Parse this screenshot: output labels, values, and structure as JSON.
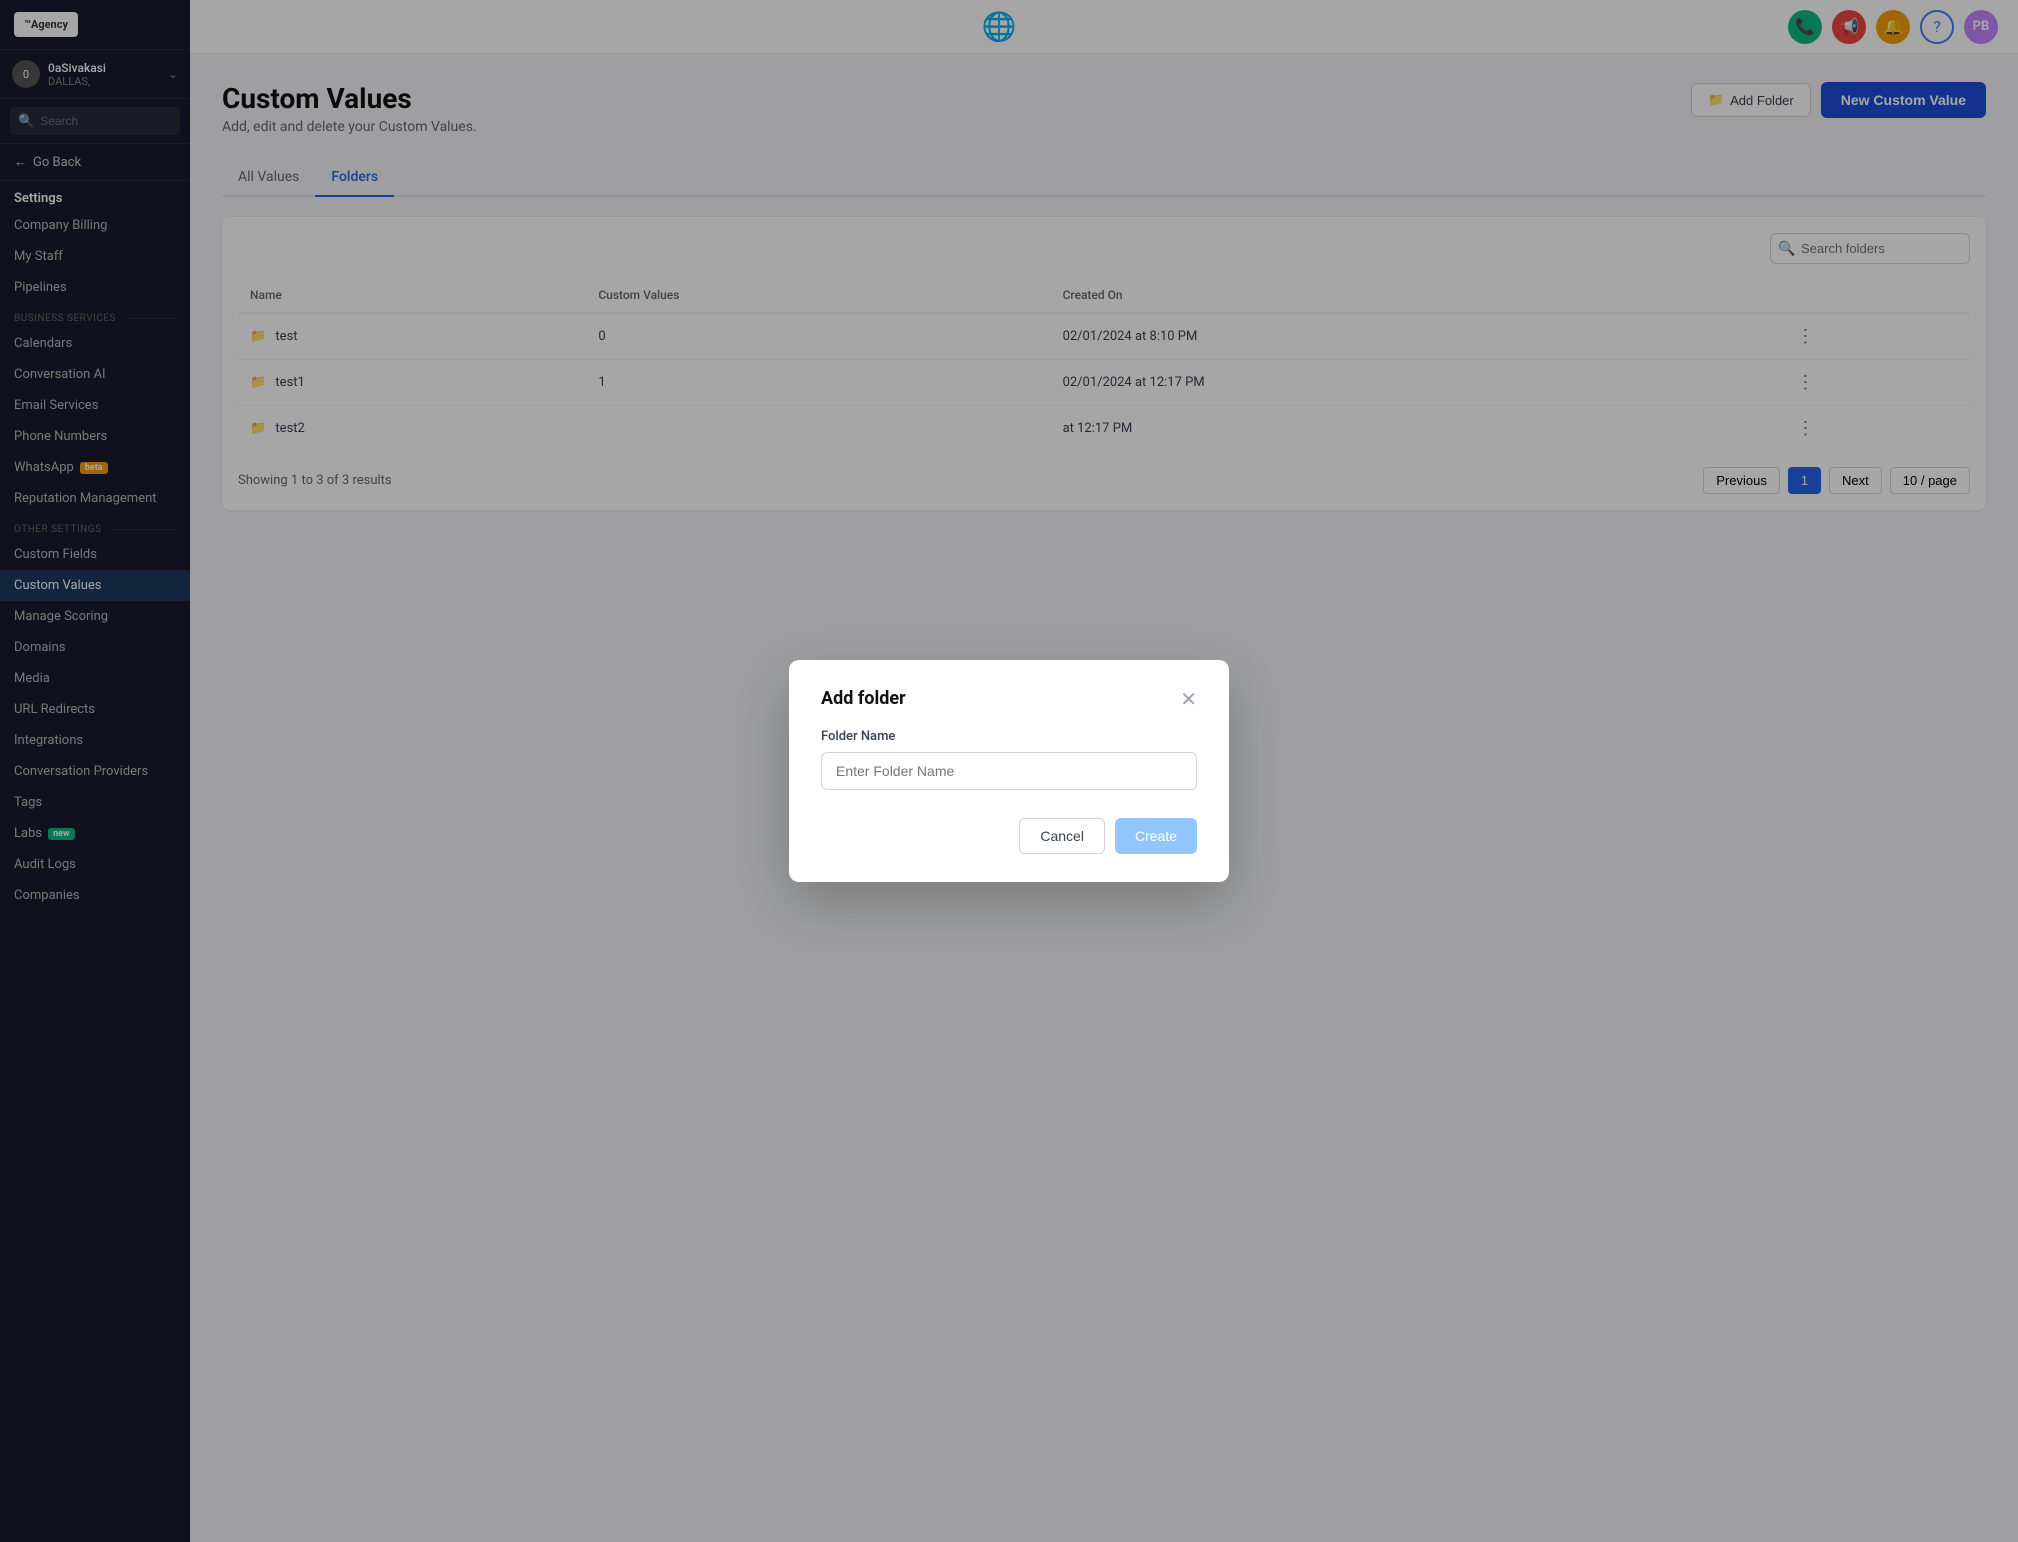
{
  "app": {
    "logo_text": "™Agency",
    "nav_logo_unicode": "🌐"
  },
  "user": {
    "name": "0aSivakasi",
    "location": "DALLAS,",
    "initials": "PB"
  },
  "sidebar": {
    "search_placeholder": "Search",
    "go_back_label": "Go Back",
    "settings_label": "Settings",
    "business_services_label": "BUSINESS SERVICES",
    "other_settings_label": "OTHER SETTINGS",
    "items_main": [
      {
        "id": "company-billing",
        "label": "Company Billing"
      },
      {
        "id": "my-staff",
        "label": "My Staff"
      },
      {
        "id": "pipelines",
        "label": "Pipelines"
      }
    ],
    "items_business": [
      {
        "id": "calendars",
        "label": "Calendars"
      },
      {
        "id": "conversation-ai",
        "label": "Conversation AI"
      },
      {
        "id": "email-services",
        "label": "Email Services"
      },
      {
        "id": "phone-numbers",
        "label": "Phone Numbers"
      },
      {
        "id": "whatsapp",
        "label": "WhatsApp",
        "badge": "beta"
      },
      {
        "id": "reputation-management",
        "label": "Reputation Management"
      }
    ],
    "items_other": [
      {
        "id": "custom-fields",
        "label": "Custom Fields"
      },
      {
        "id": "custom-values",
        "label": "Custom Values",
        "active": true
      },
      {
        "id": "manage-scoring",
        "label": "Manage Scoring"
      },
      {
        "id": "domains",
        "label": "Domains"
      },
      {
        "id": "media",
        "label": "Media"
      },
      {
        "id": "url-redirects",
        "label": "URL Redirects"
      },
      {
        "id": "integrations",
        "label": "Integrations"
      },
      {
        "id": "conversation-providers",
        "label": "Conversation Providers"
      },
      {
        "id": "tags",
        "label": "Tags"
      },
      {
        "id": "labs",
        "label": "Labs",
        "badge": "new"
      },
      {
        "id": "audit-logs",
        "label": "Audit Logs"
      },
      {
        "id": "companies",
        "label": "Companies"
      }
    ]
  },
  "page": {
    "title": "Custom Values",
    "subtitle": "Add, edit and delete your Custom Values.",
    "add_folder_btn": "Add Folder",
    "new_custom_value_btn": "New Custom Value"
  },
  "tabs": [
    {
      "id": "all-values",
      "label": "All Values"
    },
    {
      "id": "folders",
      "label": "Folders",
      "active": true
    }
  ],
  "table": {
    "search_placeholder": "Search folders",
    "columns": [
      "Name",
      "Custom Values",
      "Created On"
    ],
    "rows": [
      {
        "id": 1,
        "name": "test",
        "custom_values": "0",
        "created_on": "02/01/2024 at 8:10 PM"
      },
      {
        "id": 2,
        "name": "test1",
        "custom_values": "1",
        "created_on": "02/01/2024 at 12:17 PM"
      },
      {
        "id": 3,
        "name": "test2",
        "custom_values": "",
        "created_on": "at 12:17 PM"
      }
    ],
    "showing_text": "Showing 1 to 3 of 3 results",
    "prev_btn": "Previous",
    "next_btn": "Next",
    "current_page": "1",
    "per_page": "10 / page"
  },
  "modal": {
    "title": "Add folder",
    "label": "Folder Name",
    "input_placeholder": "Enter Folder Name",
    "cancel_btn": "Cancel",
    "create_btn": "Create"
  }
}
